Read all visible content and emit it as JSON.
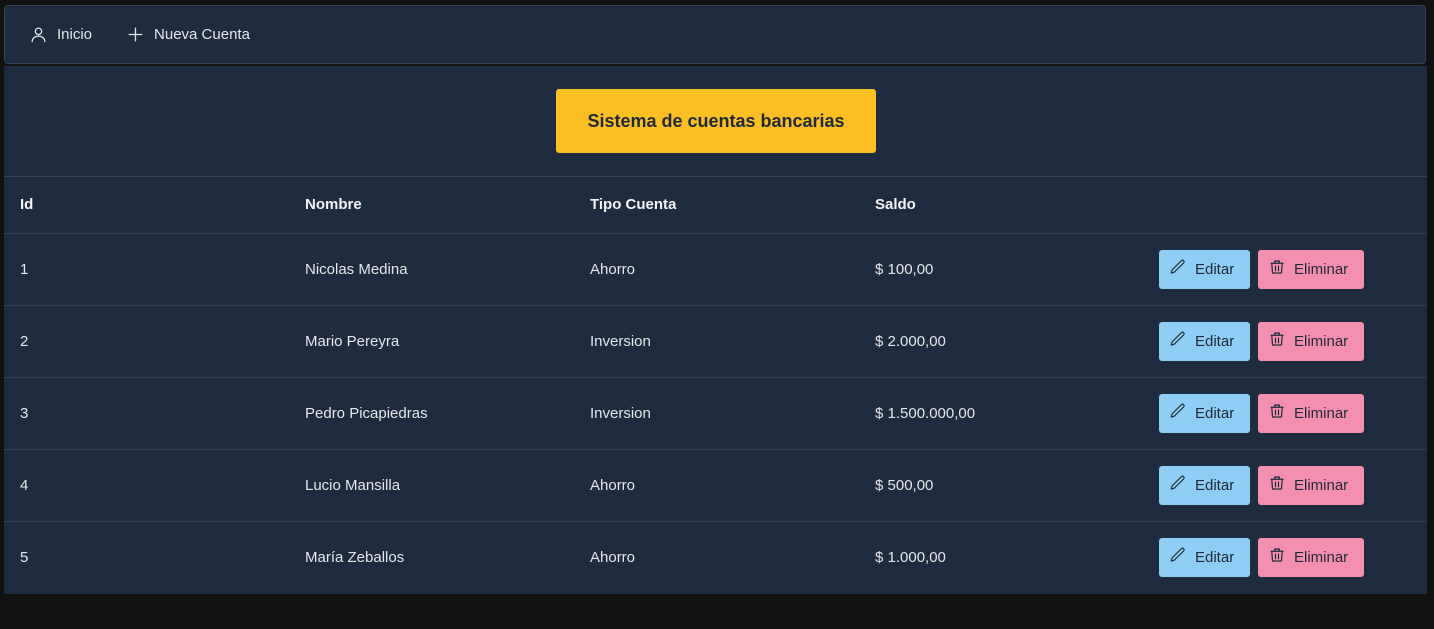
{
  "nav": {
    "items": [
      {
        "label": "Inicio",
        "icon": "user-icon"
      },
      {
        "label": "Nueva Cuenta",
        "icon": "plus-icon"
      }
    ]
  },
  "header": {
    "title": "Sistema de cuentas bancarias"
  },
  "table": {
    "columns": [
      "Id",
      "Nombre",
      "Tipo Cuenta",
      "Saldo"
    ],
    "rows": [
      {
        "id": "1",
        "nombre": "Nicolas Medina",
        "tipo": "Ahorro",
        "saldo": "$ 100,00"
      },
      {
        "id": "2",
        "nombre": "Mario Pereyra",
        "tipo": "Inversion",
        "saldo": "$ 2.000,00"
      },
      {
        "id": "3",
        "nombre": "Pedro Picapiedras",
        "tipo": "Inversion",
        "saldo": "$ 1.500.000,00"
      },
      {
        "id": "4",
        "nombre": "Lucio Mansilla",
        "tipo": "Ahorro",
        "saldo": "$ 500,00"
      },
      {
        "id": "5",
        "nombre": "María Zeballos",
        "tipo": "Ahorro",
        "saldo": "$ 1.000,00"
      }
    ],
    "edit_label": "Editar",
    "delete_label": "Eliminar"
  },
  "colors": {
    "background": "#121212",
    "panel": "#1f2b3f",
    "title_accent": "#fbbf24",
    "edit_button": "#90cdf4",
    "delete_button": "#f48fb1"
  }
}
